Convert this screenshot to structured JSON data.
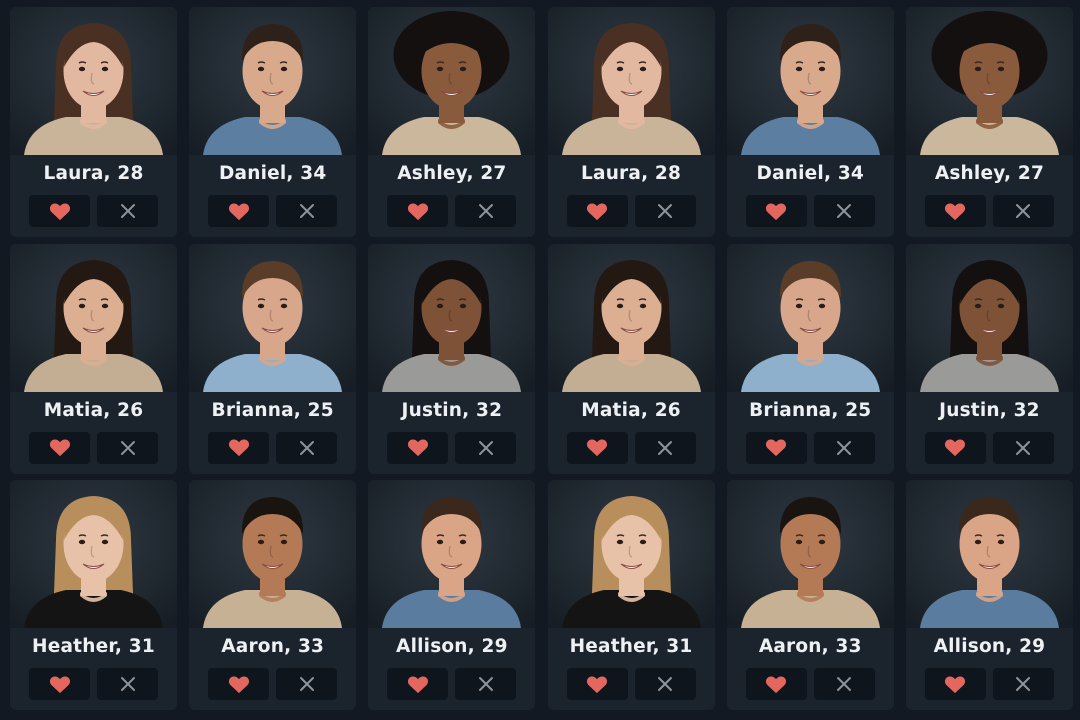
{
  "colors": {
    "background": "#121922",
    "card": "#1b232d",
    "button": "#0f151c",
    "heart": "#e4675f",
    "pass": "#8d949c",
    "name": "#eef1f4"
  },
  "icons": {
    "like": "heart-icon",
    "pass": "close-icon"
  },
  "profiles": [
    {
      "label": "Laura, 28",
      "photo": {
        "skin": "#e3b8a0",
        "hair": "#4a3022",
        "hairStyle": "long",
        "shirt": "#c9b49a"
      }
    },
    {
      "label": "Daniel, 34",
      "photo": {
        "skin": "#d9a98c",
        "hair": "#2e211a",
        "hairStyle": "short",
        "shirt": "#5c7ea1"
      }
    },
    {
      "label": "Ashley, 27",
      "photo": {
        "skin": "#8a5a3c",
        "hair": "#151010",
        "hairStyle": "curly",
        "shirt": "#cbb89c"
      }
    },
    {
      "label": "Laura, 28",
      "photo": {
        "skin": "#e3b8a0",
        "hair": "#4a3022",
        "hairStyle": "long",
        "shirt": "#c9b49a"
      }
    },
    {
      "label": "Daniel, 34",
      "photo": {
        "skin": "#d9a98c",
        "hair": "#2e211a",
        "hairStyle": "short",
        "shirt": "#5c7ea1"
      }
    },
    {
      "label": "Ashley, 27",
      "photo": {
        "skin": "#8a5a3c",
        "hair": "#151010",
        "hairStyle": "curly",
        "shirt": "#cbb89c"
      }
    },
    {
      "label": "Matia, 26",
      "photo": {
        "skin": "#dcae92",
        "hair": "#241812",
        "hairStyle": "long",
        "shirt": "#c4ae93"
      }
    },
    {
      "label": "Brianna, 25",
      "photo": {
        "skin": "#d8a68a",
        "hair": "#5a3d28",
        "hairStyle": "short",
        "shirt": "#8fb0cc"
      }
    },
    {
      "label": "Justin, 32",
      "photo": {
        "skin": "#7e5236",
        "hair": "#141010",
        "hairStyle": "long",
        "shirt": "#9a9a98"
      }
    },
    {
      "label": "Matia, 26",
      "photo": {
        "skin": "#dcae92",
        "hair": "#241812",
        "hairStyle": "long",
        "shirt": "#c4ae93"
      }
    },
    {
      "label": "Brianna, 25",
      "photo": {
        "skin": "#d8a68a",
        "hair": "#5a3d28",
        "hairStyle": "short",
        "shirt": "#8fb0cc"
      }
    },
    {
      "label": "Justin, 32",
      "photo": {
        "skin": "#7e5236",
        "hair": "#141010",
        "hairStyle": "long",
        "shirt": "#9a9a98"
      }
    },
    {
      "label": "Heather, 31",
      "photo": {
        "skin": "#e8c2a8",
        "hair": "#b88f5c",
        "hairStyle": "long",
        "shirt": "#141414"
      }
    },
    {
      "label": "Aaron, 33",
      "photo": {
        "skin": "#b47a56",
        "hair": "#1a1410",
        "hairStyle": "short",
        "shirt": "#c7b194"
      }
    },
    {
      "label": "Allison, 29",
      "photo": {
        "skin": "#d9a586",
        "hair": "#3a281c",
        "hairStyle": "short",
        "shirt": "#5a7c9e"
      }
    },
    {
      "label": "Heather, 31",
      "photo": {
        "skin": "#e8c2a8",
        "hair": "#b88f5c",
        "hairStyle": "long",
        "shirt": "#141414"
      }
    },
    {
      "label": "Aaron, 33",
      "photo": {
        "skin": "#b47a56",
        "hair": "#1a1410",
        "hairStyle": "short",
        "shirt": "#c7b194"
      }
    },
    {
      "label": "Allison, 29",
      "photo": {
        "skin": "#d9a586",
        "hair": "#3a281c",
        "hairStyle": "short",
        "shirt": "#5a7c9e"
      }
    }
  ]
}
